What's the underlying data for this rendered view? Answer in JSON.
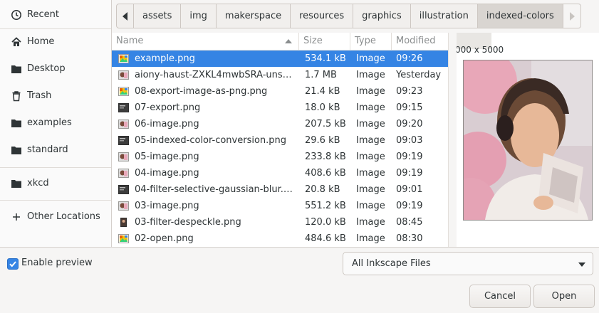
{
  "sidebar": {
    "items": [
      {
        "label": "Recent",
        "icon": "clock-icon"
      },
      {
        "label": "Home",
        "icon": "home-icon"
      },
      {
        "label": "Desktop",
        "icon": "folder-icon"
      },
      {
        "label": "Trash",
        "icon": "trash-icon"
      },
      {
        "label": "examples",
        "icon": "folder-icon"
      },
      {
        "label": "standard",
        "icon": "folder-icon"
      },
      {
        "label": "xkcd",
        "icon": "folder-icon"
      },
      {
        "label": "Other Locations",
        "icon": "plus-icon"
      }
    ]
  },
  "pathbar": {
    "crumbs": [
      "assets",
      "img",
      "makerspace",
      "resources",
      "graphics",
      "illustration",
      "indexed-colors"
    ],
    "active": "indexed-colors"
  },
  "columns": {
    "name": "Name",
    "size": "Size",
    "type": "Type",
    "modified": "Modified"
  },
  "files": [
    {
      "name": "example.png",
      "size": "534.1 kB",
      "type": "Image",
      "modified": "09:26",
      "icon": "image-thumb-icon",
      "selected": true
    },
    {
      "name": "aiony-haust-ZXKL4mwbSRA-uns…",
      "size": "1.7 MB",
      "type": "Image",
      "modified": "Yesterday",
      "icon": "photo-thumb-icon"
    },
    {
      "name": "08-export-image-as-png.png",
      "size": "21.4 kB",
      "type": "Image",
      "modified": "09:23",
      "icon": "image-thumb-icon"
    },
    {
      "name": "07-export.png",
      "size": "18.0 kB",
      "type": "Image",
      "modified": "09:15",
      "icon": "dark-thumb-icon"
    },
    {
      "name": "06-image.png",
      "size": "207.5 kB",
      "type": "Image",
      "modified": "09:20",
      "icon": "photo-thumb-icon"
    },
    {
      "name": "05-indexed-color-conversion.png",
      "size": "29.6 kB",
      "type": "Image",
      "modified": "09:03",
      "icon": "dark-thumb-icon"
    },
    {
      "name": "05-image.png",
      "size": "233.8 kB",
      "type": "Image",
      "modified": "09:19",
      "icon": "photo-thumb-icon"
    },
    {
      "name": "04-image.png",
      "size": "408.6 kB",
      "type": "Image",
      "modified": "09:19",
      "icon": "photo-thumb-icon"
    },
    {
      "name": "04-filter-selective-gaussian-blur.…",
      "size": "20.8 kB",
      "type": "Image",
      "modified": "09:01",
      "icon": "dark-thumb-icon"
    },
    {
      "name": "03-image.png",
      "size": "551.2 kB",
      "type": "Image",
      "modified": "09:19",
      "icon": "photo-thumb-icon"
    },
    {
      "name": "03-filter-despeckle.png",
      "size": "120.0 kB",
      "type": "Image",
      "modified": "08:45",
      "icon": "portrait-thumb-icon"
    },
    {
      "name": "02-open.png",
      "size": "484.6 kB",
      "type": "Image",
      "modified": "08:30",
      "icon": "image-thumb-icon"
    }
  ],
  "preview": {
    "dimensions": "000 x 5000"
  },
  "enable_preview": {
    "label": "Enable preview",
    "checked": true
  },
  "filter": {
    "selected": "All Inkscape Files"
  },
  "buttons": {
    "cancel": "Cancel",
    "open": "Open"
  },
  "colors": {
    "accent": "#3584e4",
    "background": "#f6f5f4"
  }
}
